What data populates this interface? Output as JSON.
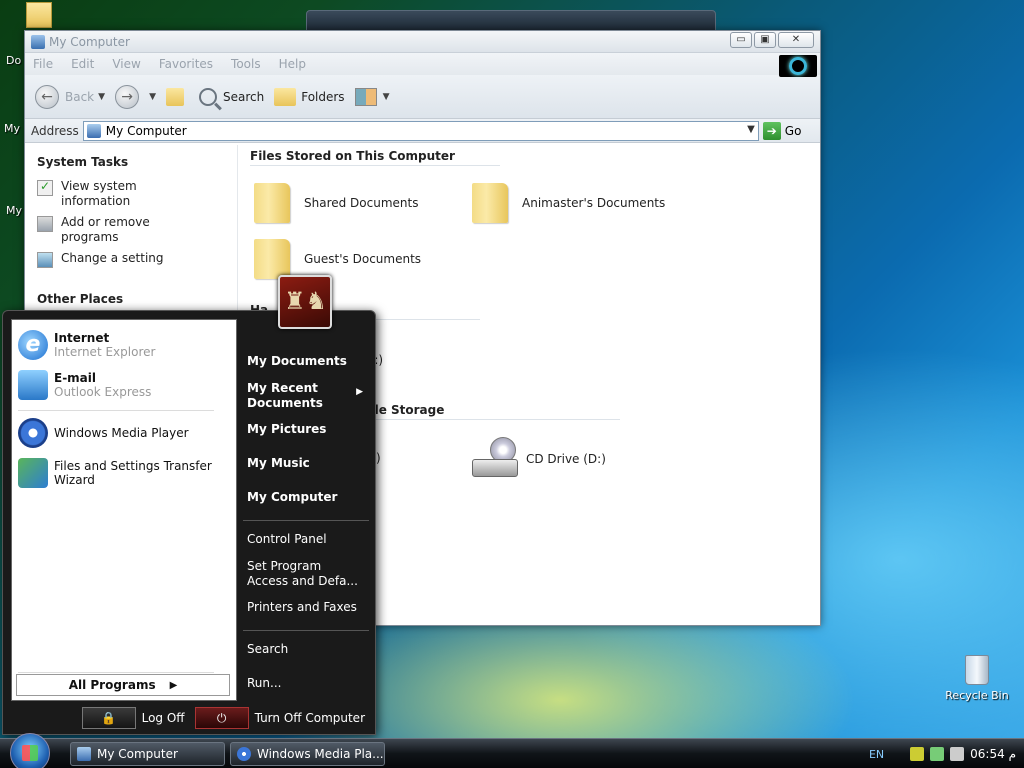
{
  "desktop": {
    "partial_labels": [
      "Do",
      "My",
      "My"
    ],
    "recycle_bin": "Recycle Bin"
  },
  "window": {
    "title": "My Computer",
    "controls": {
      "minimize": "▭",
      "maximize": "▣",
      "close": "✕"
    },
    "menu": [
      "File",
      "Edit",
      "View",
      "Favorites",
      "Tools",
      "Help"
    ],
    "toolbar": {
      "back": "Back",
      "search": "Search",
      "folders": "Folders"
    },
    "address": {
      "label": "Address",
      "value": "My Computer",
      "go": "Go"
    },
    "tasks": {
      "system_tasks_title": "System Tasks",
      "items": [
        "View system information",
        "Add or remove programs",
        "Change a setting"
      ],
      "other_places_title": "Other Places"
    },
    "files": {
      "section_stored": "Files Stored on This Computer",
      "folders": [
        "Shared Documents",
        "Animaster's Documents",
        "Guest's Documents"
      ],
      "partial_hard_heading": "Ha",
      "partial_local": "C:)",
      "partial_removable_heading": "ble Storage",
      "partial_removable_item": ":)",
      "cd_drive": "CD Drive (D:)"
    }
  },
  "start_menu": {
    "pinned": [
      {
        "title": "Internet",
        "sub": "Internet Explorer"
      },
      {
        "title": "E-mail",
        "sub": "Outlook Express"
      }
    ],
    "recent": [
      "Windows Media Player",
      "Files and Settings Transfer Wizard"
    ],
    "all_programs": "All Programs",
    "right": {
      "my_documents": "My Documents",
      "my_recent": "My Recent Documents",
      "my_pictures": "My Pictures",
      "my_music": "My Music",
      "my_computer": "My Computer",
      "control_panel": "Control Panel",
      "set_program": "Set Program Access and Defa...",
      "printers": "Printers and Faxes",
      "search": "Search",
      "run": "Run..."
    },
    "log_off": "Log Off",
    "turn_off": "Turn Off Computer"
  },
  "taskbar": {
    "tasks": [
      "My Computer",
      "Windows Media Pla..."
    ],
    "lang": "EN",
    "clock": "06:54 م"
  }
}
